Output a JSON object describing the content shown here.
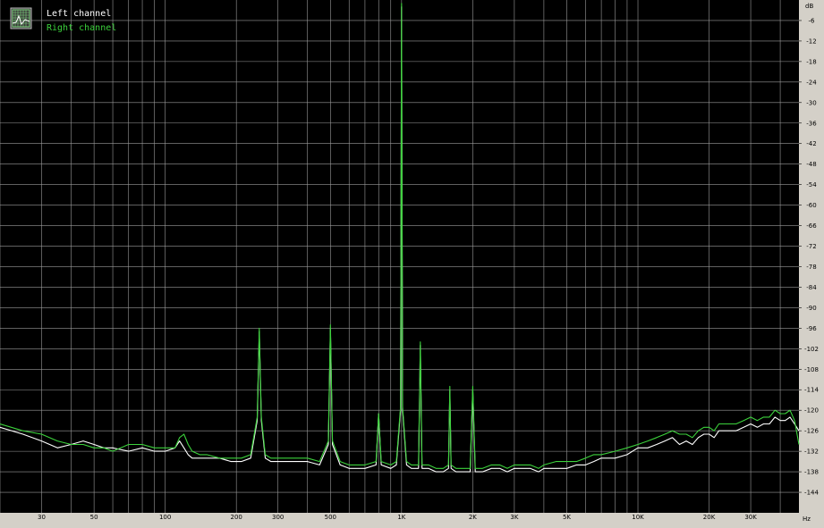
{
  "chart_data": {
    "type": "line",
    "xscale": "log",
    "xlim": [
      20,
      48000
    ],
    "ylim": [
      -150,
      0
    ],
    "y_unit": "dB",
    "x_unit": "Hz",
    "grid": true,
    "background": "#000000",
    "grid_color": "#9a9a9a",
    "axis_panel_color": "#d4d0c8",
    "legend_placement": "top-left",
    "x_ticks": [
      {
        "value": 30,
        "label": "30"
      },
      {
        "value": 50,
        "label": "50"
      },
      {
        "value": 100,
        "label": "100"
      },
      {
        "value": 200,
        "label": "200"
      },
      {
        "value": 300,
        "label": "300"
      },
      {
        "value": 500,
        "label": "500"
      },
      {
        "value": 1000,
        "label": "1K"
      },
      {
        "value": 2000,
        "label": "2K"
      },
      {
        "value": 3000,
        "label": "3K"
      },
      {
        "value": 5000,
        "label": "5K"
      },
      {
        "value": 10000,
        "label": "10K"
      },
      {
        "value": 20000,
        "label": "20K"
      },
      {
        "value": 30000,
        "label": "30K"
      }
    ],
    "y_ticks": [
      -6,
      -12,
      -18,
      -24,
      -30,
      -36,
      -42,
      -48,
      -54,
      -60,
      -66,
      -72,
      -78,
      -84,
      -90,
      -96,
      -102,
      -108,
      -114,
      -120,
      -126,
      -132,
      -138,
      -144
    ],
    "legend": {
      "icon": "grid-chart-icon"
    },
    "series": [
      {
        "name": "Left channel",
        "color": "#ffffff",
        "x": [
          20,
          25,
          30,
          35,
          40,
          45,
          50,
          55,
          60,
          70,
          80,
          90,
          100,
          110,
          115,
          120,
          125,
          130,
          140,
          150,
          170,
          190,
          210,
          230,
          245,
          250,
          255,
          265,
          280,
          300,
          350,
          400,
          450,
          490,
          500,
          510,
          550,
          600,
          650,
          700,
          780,
          800,
          820,
          900,
          950,
          990,
          1000,
          1010,
          1050,
          1100,
          1180,
          1200,
          1220,
          1300,
          1400,
          1500,
          1580,
          1600,
          1620,
          1700,
          1800,
          1950,
          2000,
          2050,
          2200,
          2400,
          2600,
          2800,
          3000,
          3200,
          3500,
          3800,
          4000,
          4500,
          5000,
          5500,
          6000,
          6500,
          7000,
          8000,
          9000,
          10000,
          11000,
          12000,
          13000,
          14000,
          15000,
          16000,
          17000,
          18000,
          19000,
          20000,
          21000,
          22000,
          24000,
          26000,
          28000,
          30000,
          32000,
          34000,
          36000,
          38000,
          40000,
          42000,
          44000,
          46000,
          48000
        ],
        "y": [
          -125,
          -127,
          -129,
          -131,
          -130,
          -129,
          -130,
          -131,
          -131,
          -132,
          -131,
          -132,
          -132,
          -131,
          -129,
          -131,
          -133,
          -134,
          -134,
          -134,
          -134,
          -135,
          -135,
          -134,
          -123,
          -97,
          -123,
          -134,
          -135,
          -135,
          -135,
          -135,
          -136,
          -130,
          -96,
          -130,
          -136,
          -137,
          -137,
          -137,
          -136,
          -121,
          -136,
          -137,
          -136,
          -120,
          -2,
          -120,
          -136,
          -137,
          -137,
          -101,
          -137,
          -137,
          -138,
          -138,
          -137,
          -114,
          -137,
          -138,
          -138,
          -138,
          -114,
          -138,
          -138,
          -137,
          -137,
          -138,
          -137,
          -137,
          -137,
          -138,
          -137,
          -137,
          -137,
          -136,
          -136,
          -135,
          -134,
          -134,
          -133,
          -131,
          -131,
          -130,
          -129,
          -128,
          -130,
          -129,
          -130,
          -128,
          -127,
          -127,
          -128,
          -126,
          -126,
          -126,
          -125,
          -124,
          -125,
          -124,
          -124,
          -122,
          -123,
          -123,
          -122,
          -124,
          -126
        ]
      },
      {
        "name": "Right channel",
        "color": "#3cd23c",
        "x": [
          20,
          25,
          30,
          35,
          40,
          45,
          50,
          55,
          60,
          70,
          80,
          90,
          100,
          110,
          115,
          120,
          125,
          130,
          140,
          150,
          170,
          190,
          210,
          230,
          245,
          250,
          255,
          265,
          280,
          300,
          350,
          400,
          450,
          490,
          500,
          510,
          550,
          600,
          650,
          700,
          780,
          800,
          820,
          900,
          950,
          990,
          1000,
          1010,
          1050,
          1100,
          1180,
          1200,
          1220,
          1300,
          1400,
          1500,
          1580,
          1600,
          1620,
          1700,
          1800,
          1950,
          2000,
          2050,
          2200,
          2400,
          2600,
          2800,
          3000,
          3200,
          3500,
          3800,
          4000,
          4500,
          5000,
          5500,
          6000,
          6500,
          7000,
          8000,
          9000,
          10000,
          11000,
          12000,
          13000,
          14000,
          15000,
          16000,
          17000,
          18000,
          19000,
          20000,
          21000,
          22000,
          24000,
          26000,
          28000,
          30000,
          32000,
          34000,
          36000,
          38000,
          40000,
          42000,
          44000,
          46000,
          48000
        ],
        "y": [
          -124,
          -126,
          -127,
          -129,
          -130,
          -130,
          -131,
          -131,
          -132,
          -130,
          -130,
          -131,
          -131,
          -131,
          -128,
          -127,
          -130,
          -132,
          -133,
          -133,
          -134,
          -134,
          -134,
          -133,
          -122,
          -96,
          -122,
          -133,
          -134,
          -134,
          -134,
          -134,
          -135,
          -129,
          -95,
          -129,
          -135,
          -136,
          -136,
          -136,
          -135,
          -121,
          -135,
          -136,
          -135,
          -119,
          -1,
          -119,
          -135,
          -136,
          -136,
          -100,
          -136,
          -136,
          -137,
          -137,
          -136,
          -113,
          -136,
          -137,
          -137,
          -137,
          -113,
          -137,
          -137,
          -136,
          -136,
          -137,
          -136,
          -136,
          -136,
          -137,
          -136,
          -135,
          -135,
          -135,
          -134,
          -133,
          -133,
          -132,
          -131,
          -130,
          -129,
          -128,
          -127,
          -126,
          -127,
          -127,
          -128,
          -126,
          -125,
          -125,
          -126,
          -124,
          -124,
          -124,
          -123,
          -122,
          -123,
          -122,
          -122,
          -120,
          -121,
          -121,
          -120,
          -123,
          -130
        ]
      }
    ]
  }
}
